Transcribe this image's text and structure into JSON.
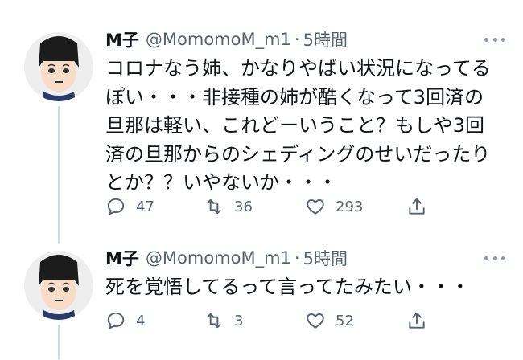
{
  "tweets": [
    {
      "name": "M子",
      "handle": "@MomomoM_m1",
      "separator": "·",
      "time": "5時間",
      "text": "コロナなう姉、かなりやばい状況になってるぽい・・・非接種の姉が酷くなって3回済の旦那は軽い、これどーいうこと？もしや3回済の旦那からのシェディングのせいだったりとか？？いやないか・・・",
      "replies": "47",
      "retweets": "36",
      "likes": "293"
    },
    {
      "name": "M子",
      "handle": "@MomomoM_m1",
      "separator": "·",
      "time": "5時間",
      "text": "死を覚悟してるって言ってたみたい・・・",
      "replies": "4",
      "retweets": "3",
      "likes": "52"
    }
  ],
  "icons": {
    "reply": "reply-icon",
    "retweet": "retweet-icon",
    "like": "heart-icon",
    "share": "share-icon",
    "more": "more-icon"
  },
  "colors": {
    "text": "#0f1419",
    "secondary": "#536471",
    "thread_line": "#cfd9de"
  }
}
